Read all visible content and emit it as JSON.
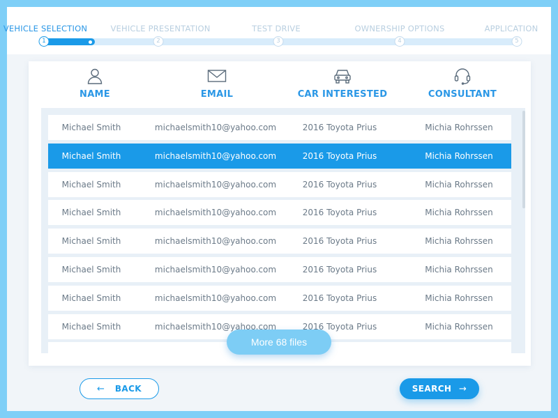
{
  "stepper": {
    "steps": [
      {
        "label": "VEHICLE SELECTION",
        "number": "1"
      },
      {
        "label": "VEHICLE PRESENTATION",
        "number": "2"
      },
      {
        "label": "TEST DRIVE",
        "number": "3"
      },
      {
        "label": "OWNERSHIP OPTIONS",
        "number": "4"
      },
      {
        "label": "APPLICATION",
        "number": "5"
      }
    ],
    "active_step": 1
  },
  "table": {
    "columns": [
      {
        "label": "NAME",
        "icon": "user-icon"
      },
      {
        "label": "EMAIL",
        "icon": "envelope-icon"
      },
      {
        "label": "CAR INTERESTED",
        "icon": "car-icon"
      },
      {
        "label": "CONSULTANT",
        "icon": "headset-icon"
      }
    ],
    "rows": [
      [
        "Michael Smith",
        "michaelsmith10@yahoo.com",
        "2016 Toyota Prius",
        "Michia Rohrssen"
      ],
      [
        "Michael Smith",
        "michaelsmith10@yahoo.com",
        "2016 Toyota Prius",
        "Michia Rohrssen"
      ],
      [
        "Michael Smith",
        "michaelsmith10@yahoo.com",
        "2016 Toyota Prius",
        "Michia Rohrssen"
      ],
      [
        "Michael Smith",
        "michaelsmith10@yahoo.com",
        "2016 Toyota Prius",
        "Michia Rohrssen"
      ],
      [
        "Michael Smith",
        "michaelsmith10@yahoo.com",
        "2016 Toyota Prius",
        "Michia Rohrssen"
      ],
      [
        "Michael Smith",
        "michaelsmith10@yahoo.com",
        "2016 Toyota Prius",
        "Michia Rohrssen"
      ],
      [
        "Michael Smith",
        "michaelsmith10@yahoo.com",
        "2016 Toyota Prius",
        "Michia Rohrssen"
      ],
      [
        "Michael Smith",
        "michaelsmith10@yahoo.com",
        "2016 Toyota Prius",
        "Michia Rohrssen"
      ]
    ],
    "selected_row": 2,
    "more_label": "More 68 files"
  },
  "actions": {
    "back_label": "BACK",
    "back_arrow": "←",
    "search_label": "SEARCH",
    "search_arrow": "→"
  },
  "colors": {
    "accent": "#1a9ae8",
    "background": "#7fcff7",
    "inactive": "#b9cfe0"
  }
}
